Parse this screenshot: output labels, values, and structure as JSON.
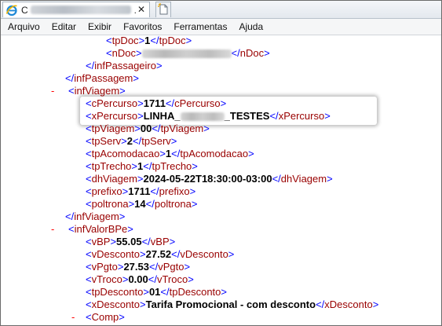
{
  "window": {
    "tab_dot": ".",
    "tab_close": "✕",
    "tab_icon": "ie-icon",
    "new_tab_icon": "new-tab-icon"
  },
  "menu": [
    "Arquivo",
    "Editar",
    "Exibir",
    "Favoritos",
    "Ferramentas",
    "Ajuda"
  ],
  "colors": {
    "tag_name": "#990000",
    "bracket": "#0000ff",
    "collapse_minus": "#ff0000",
    "value": "#000000"
  },
  "xml": {
    "tpDoc": {
      "open": "tpDoc",
      "value": "1",
      "close": "tpDoc"
    },
    "nDoc": {
      "open": "nDoc",
      "close": "nDoc"
    },
    "infPassageiro_close": "infPassageiro",
    "infPassagem_close": "infPassagem",
    "infViagem_open": "infViagem",
    "cPercurso": {
      "open": "cPercurso",
      "value": "1711",
      "close": "cPercurso"
    },
    "xPercurso": {
      "open": "xPercurso",
      "value_prefix": "LINHA_",
      "value_suffix": "_TESTES",
      "close": "xPercurso"
    },
    "tpViagem": {
      "open": "tpViagem",
      "value": "00",
      "close": "tpViagem"
    },
    "tpServ": {
      "open": "tpServ",
      "value": "2",
      "close": "tpServ"
    },
    "tpAcomodacao": {
      "open": "tpAcomodacao",
      "value": "1",
      "close": "tpAcomodacao"
    },
    "tpTrecho": {
      "open": "tpTrecho",
      "value": "1",
      "close": "tpTrecho"
    },
    "dhViagem": {
      "open": "dhViagem",
      "value": "2024-05-22T18:30:00-03:00",
      "close": "dhViagem"
    },
    "prefixo": {
      "open": "prefixo",
      "value": "1711",
      "close": "prefixo"
    },
    "poltrona": {
      "open": "poltrona",
      "value": "14",
      "close": "poltrona"
    },
    "infViagem_close": "infViagem",
    "infValorBPe_open": "infValorBPe",
    "vBP": {
      "open": "vBP",
      "value": "55.05",
      "close": "vBP"
    },
    "vDesconto": {
      "open": "vDesconto",
      "value": "27.52",
      "close": "vDesconto"
    },
    "vPgto": {
      "open": "vPgto",
      "value": "27.53",
      "close": "vPgto"
    },
    "vTroco": {
      "open": "vTroco",
      "value": "0.00",
      "close": "vTroco"
    },
    "tpDesconto": {
      "open": "tpDesconto",
      "value": "01",
      "close": "tpDesconto"
    },
    "xDesconto": {
      "open": "xDesconto",
      "value": "Tarifa Promocional - com desconto",
      "close": "xDesconto"
    },
    "Comp_open": "Comp",
    "minus": "-"
  }
}
